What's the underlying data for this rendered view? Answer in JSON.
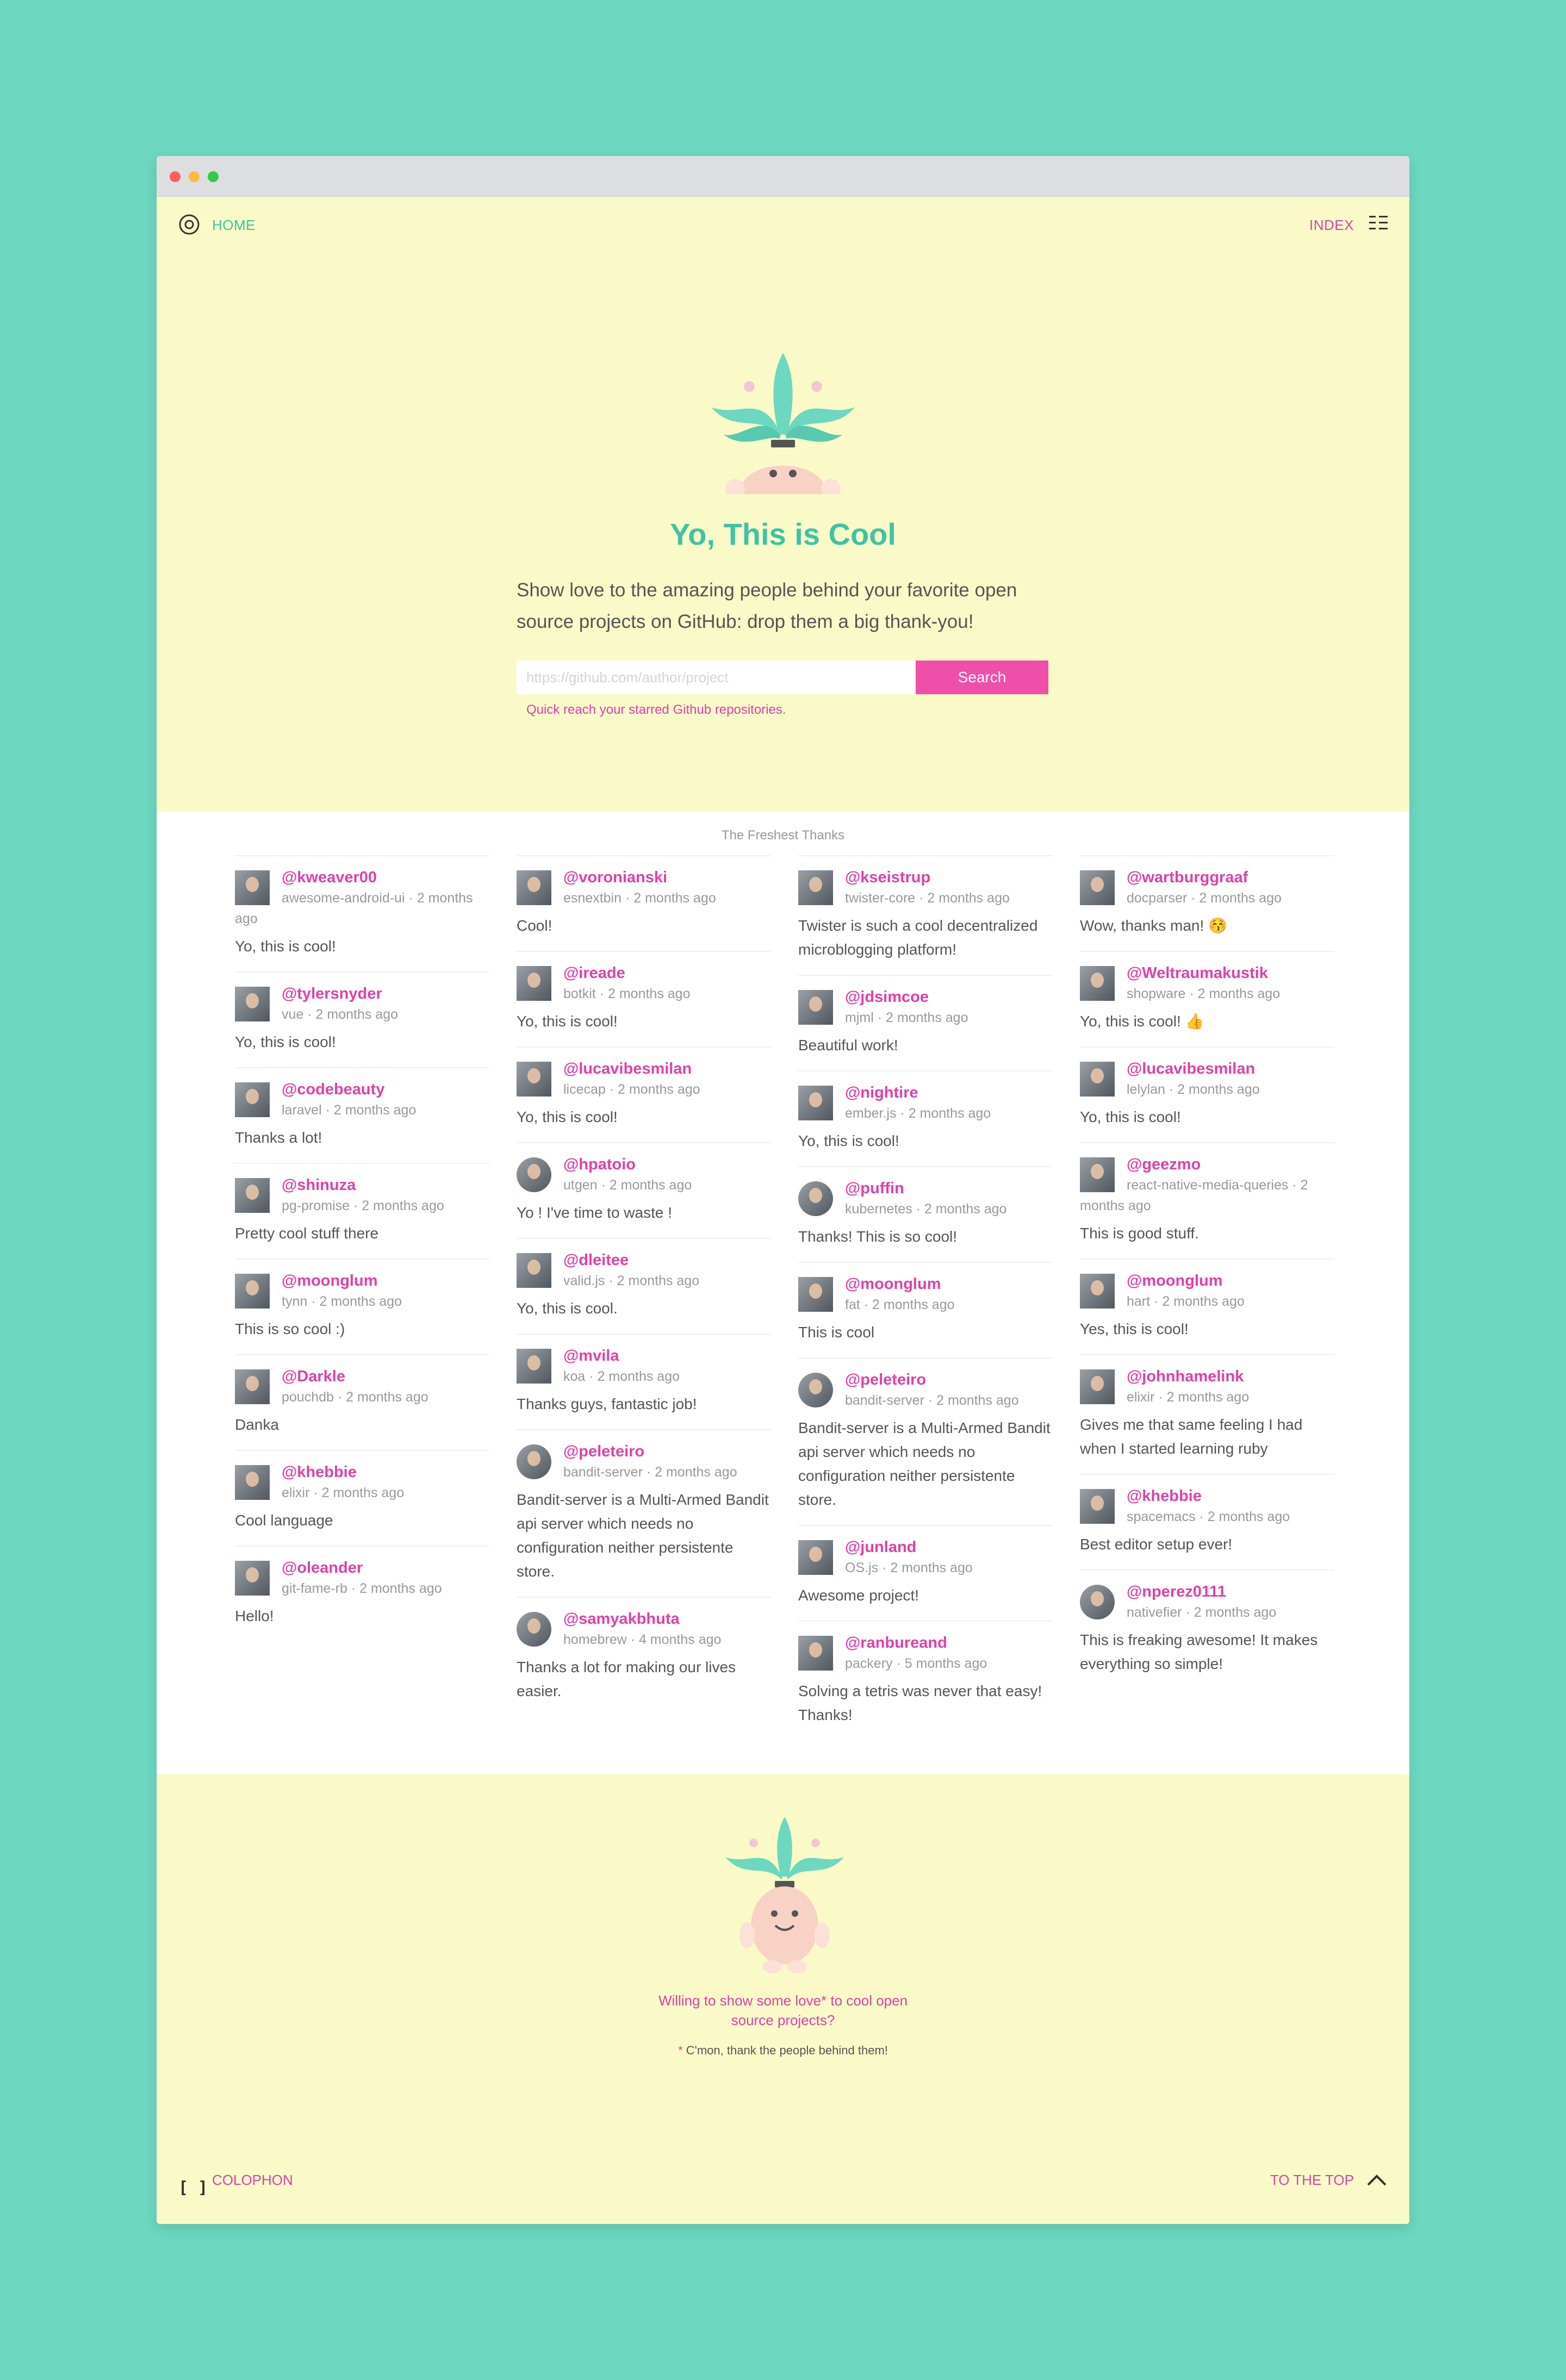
{
  "nav": {
    "home_label": "HOME",
    "index_label": "INDEX"
  },
  "hero": {
    "title": "Yo, This is Cool",
    "description": "Show love to the amazing people behind your favorite open source projects on GitHub: drop them a big thank-you!",
    "search_placeholder": "https://github.com/author/project",
    "search_button": "Search",
    "hint": "Quick reach your starred Github repositories."
  },
  "thanks": {
    "heading": "The Freshest Thanks",
    "columns": [
      [
        {
          "user": "@kweaver00",
          "repo": "awesome-android-ui",
          "time": "2 months ago",
          "message": "Yo, this is cool!"
        },
        {
          "user": "@tylersnyder",
          "repo": "vue",
          "time": "2 months ago",
          "message": "Yo, this is cool!"
        },
        {
          "user": "@codebeauty",
          "repo": "laravel",
          "time": "2 months ago",
          "message": "Thanks a lot!"
        },
        {
          "user": "@shinuza",
          "repo": "pg-promise",
          "time": "2 months ago",
          "message": "Pretty cool stuff there"
        },
        {
          "user": "@moonglum",
          "repo": "tynn",
          "time": "2 months ago",
          "message": "This is so cool :)"
        },
        {
          "user": "@Darkle",
          "repo": "pouchdb",
          "time": "2 months ago",
          "message": "Danka"
        },
        {
          "user": "@khebbie",
          "repo": "elixir",
          "time": "2 months ago",
          "message": "Cool language"
        },
        {
          "user": "@oleander",
          "repo": "git-fame-rb",
          "time": "2 months ago",
          "message": "Hello!"
        }
      ],
      [
        {
          "user": "@voronianski",
          "repo": "esnextbin",
          "time": "2 months ago",
          "message": "Cool!"
        },
        {
          "user": "@ireade",
          "repo": "botkit",
          "time": "2 months ago",
          "message": "Yo, this is cool!"
        },
        {
          "user": "@lucavibesmilan",
          "repo": "licecap",
          "time": "2 months ago",
          "message": "Yo, this is cool!"
        },
        {
          "user": "@hpatoio",
          "repo": "utgen",
          "time": "2 months ago",
          "message": "Yo ! I've time to waste !"
        },
        {
          "user": "@dleitee",
          "repo": "valid.js",
          "time": "2 months ago",
          "message": "Yo, this is cool."
        },
        {
          "user": "@mvila",
          "repo": "koa",
          "time": "2 months ago",
          "message": "Thanks guys, fantastic job!"
        },
        {
          "user": "@peleteiro",
          "repo": "bandit-server",
          "time": "2 months ago",
          "message": "Bandit-server is a Multi-Armed Bandit api server which needs no configuration neither persistente store."
        },
        {
          "user": "@samyakbhuta",
          "repo": "homebrew",
          "time": "4 months ago",
          "message": "Thanks a lot for making our lives easier."
        }
      ],
      [
        {
          "user": "@kseistrup",
          "repo": "twister-core",
          "time": "2 months ago",
          "message": "Twister is such a cool decentralized microblogging platform!"
        },
        {
          "user": "@jdsimcoe",
          "repo": "mjml",
          "time": "2 months ago",
          "message": "Beautiful work!"
        },
        {
          "user": "@nightire",
          "repo": "ember.js",
          "time": "2 months ago",
          "message": "Yo, this is cool!"
        },
        {
          "user": "@puffin",
          "repo": "kubernetes",
          "time": "2 months ago",
          "message": "Thanks! This is so cool!"
        },
        {
          "user": "@moonglum",
          "repo": "fat",
          "time": "2 months ago",
          "message": "This is cool"
        },
        {
          "user": "@peleteiro",
          "repo": "bandit-server",
          "time": "2 months ago",
          "message": "Bandit-server is a Multi-Armed Bandit api server which needs no configuration neither persistente store."
        },
        {
          "user": "@junland",
          "repo": "OS.js",
          "time": "2 months ago",
          "message": "Awesome project!"
        },
        {
          "user": "@ranbureand",
          "repo": "packery",
          "time": "5 months ago",
          "message": "Solving a tetris was never that easy! Thanks!"
        }
      ],
      [
        {
          "user": "@wartburggraaf",
          "repo": "docparser",
          "time": "2 months ago",
          "message": "Wow, thanks man! 😚"
        },
        {
          "user": "@Weltraumakustik",
          "repo": "shopware",
          "time": "2 months ago",
          "message": "Yo, this is cool! 👍"
        },
        {
          "user": "@lucavibesmilan",
          "repo": "lelylan",
          "time": "2 months ago",
          "message": "Yo, this is cool!"
        },
        {
          "user": "@geezmo",
          "repo": "react-native-media-queries",
          "time": "2 months ago",
          "message": "This is good stuff."
        },
        {
          "user": "@moonglum",
          "repo": "hart",
          "time": "2 months ago",
          "message": "Yes, this is cool!"
        },
        {
          "user": "@johnhamelink",
          "repo": "elixir",
          "time": "2 months ago",
          "message": "Gives me that same feeling I had when I started learning ruby"
        },
        {
          "user": "@khebbie",
          "repo": "spacemacs",
          "time": "2 months ago",
          "message": "Best editor setup ever!"
        },
        {
          "user": "@nperez0111",
          "repo": "nativefier",
          "time": "2 months ago",
          "message": "This is freaking awesome! It makes everything so simple!"
        }
      ]
    ]
  },
  "footer": {
    "cta": "Willing to show some love* to cool open source projects?",
    "note_star": "*",
    "note": " C'mon, thank the people behind them!",
    "colophon_icon": "[ ]",
    "colophon_label": "COLOPHON",
    "top_label": "TO THE TOP"
  },
  "colors": {
    "page_background": "#6dd7bf",
    "cream": "#fafac9",
    "teal": "#3cc4a6",
    "pink": "#e040a8",
    "button_pink": "#ef4fa9"
  },
  "icons": {
    "home": "eye-icon",
    "index": "grid-list-icon",
    "colophon": "brackets-icon",
    "top": "chevron-up-icon"
  }
}
